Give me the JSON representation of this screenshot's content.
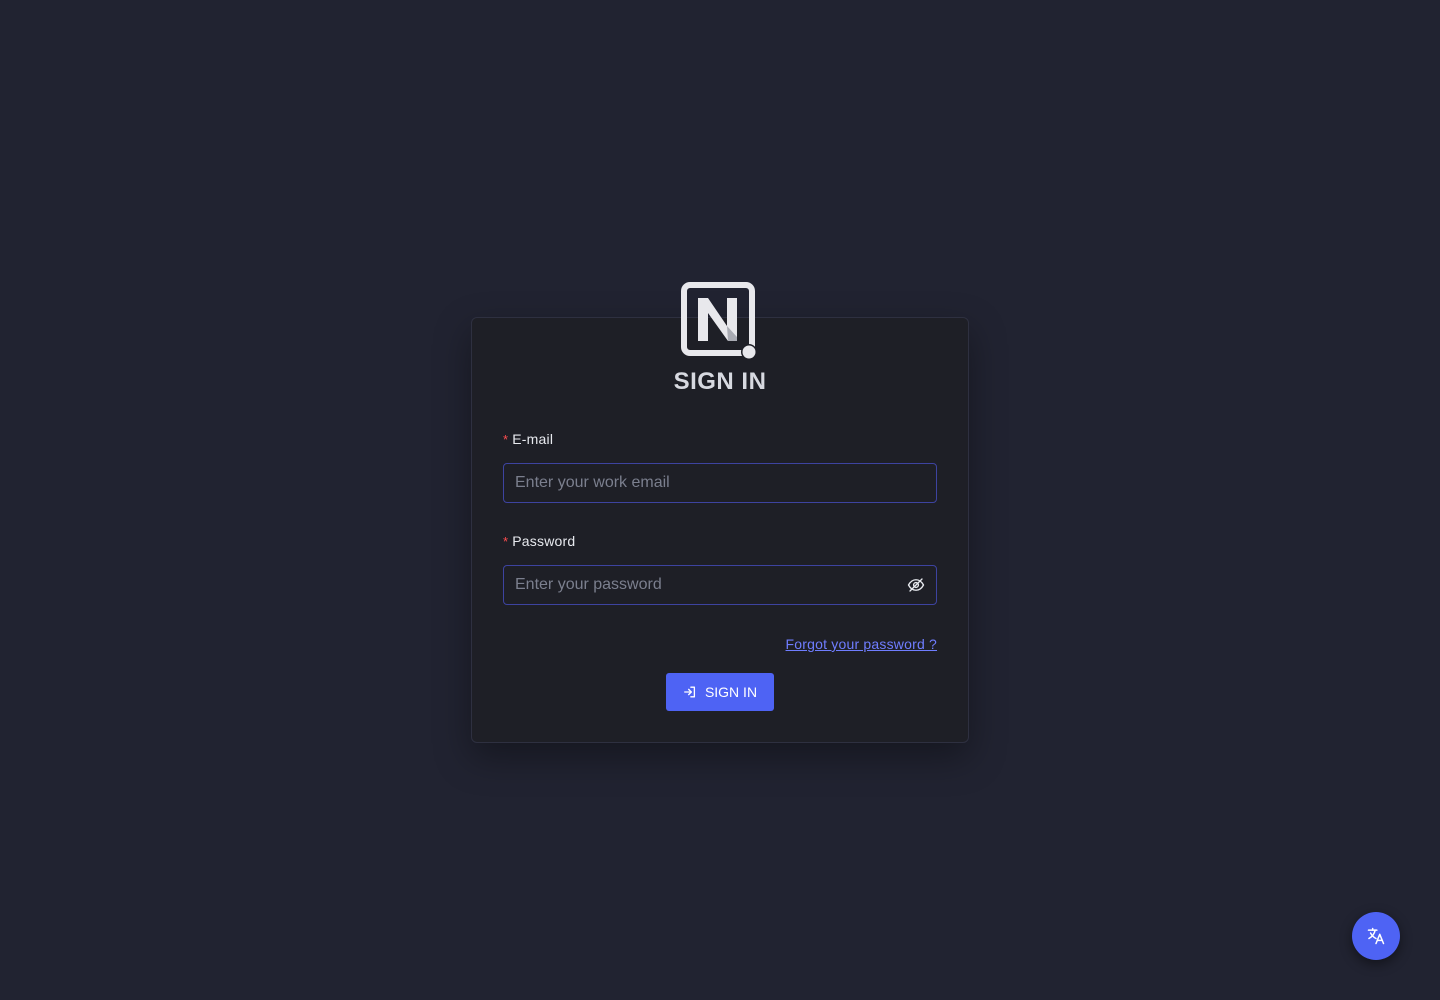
{
  "theme": {
    "background": "#212331",
    "card_background": "#1e1f26",
    "accent": "#4e63f4",
    "link": "#6f7dff",
    "required_marker": "#ff4d4f",
    "input_border": "#3d43a0"
  },
  "brand": {
    "logo_icon": "n-logo-icon"
  },
  "form": {
    "title": "SIGN IN",
    "email": {
      "required_mark": "*",
      "label": "E-mail",
      "value": "",
      "placeholder": "Enter your work email"
    },
    "password": {
      "required_mark": "*",
      "label": "Password",
      "value": "",
      "placeholder": "Enter your password",
      "toggle_icon": "eye-slash-icon"
    },
    "forgot_password_link": "Forgot your password ?",
    "submit": {
      "label": "SIGN IN",
      "icon": "login-icon"
    }
  },
  "language_button": {
    "icon": "translate-icon"
  }
}
